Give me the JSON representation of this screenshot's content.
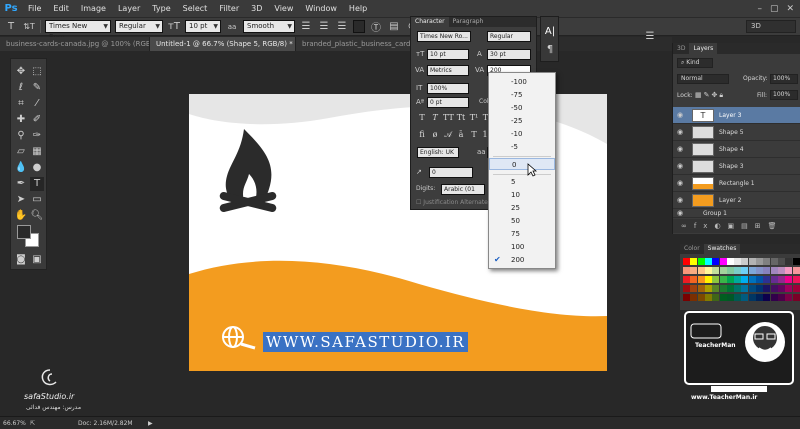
{
  "app": {
    "logo": "Ps"
  },
  "menu": [
    "File",
    "Edit",
    "Image",
    "Layer",
    "Type",
    "Select",
    "Filter",
    "3D",
    "View",
    "Window",
    "Help"
  ],
  "window_controls": [
    "–",
    "▢",
    "✕"
  ],
  "options_bar": {
    "font_family": "Times New Rom...",
    "font_style": "Regular",
    "font_size": "10 pt",
    "antialias_label": "aa",
    "antialias": "Smooth",
    "workspace": "3D"
  },
  "doc_tabs": [
    {
      "label": "business-cards-canada.jpg @ 100% (RGB/8#)",
      "active": false
    },
    {
      "label": "Untitled-1 @ 66.7% (Shape 5, RGB/8) *",
      "active": true
    },
    {
      "label": "branded_plastic_business_card_1.jpg",
      "active": false
    }
  ],
  "canvas": {
    "url_text": "WWW.SAFASTUDIO.IR",
    "colors": {
      "orange": "#f39c1f",
      "gray_wave": "#e6e6e6",
      "dark": "#2b2b2b",
      "selection": "#3a72c4"
    }
  },
  "character_panel": {
    "tabs": [
      "Character",
      "Paragraph"
    ],
    "font_family": "Times New Ro...",
    "font_style": "Regular",
    "font_size": "10 pt",
    "leading": "30 pt",
    "kerning": "Metrics",
    "tracking": "200",
    "vertical_scale": "100%",
    "baseline_shift": "0 pt",
    "color_label": "Colo",
    "language": "English: UK",
    "antialias_short": "Sm",
    "digits_label": "Digits:",
    "digits_value": "Arabic (01",
    "justification_label": "Justification Alternate",
    "mini_value": "0"
  },
  "tracking_dropdown": {
    "options": [
      "-100",
      "-75",
      "-50",
      "-25",
      "-10",
      "-5",
      "0",
      "5",
      "10",
      "25",
      "50",
      "75",
      "100",
      "200"
    ],
    "selected": "200",
    "highlighted": "0"
  },
  "layers_panel": {
    "tabs": [
      "3D",
      "Layers"
    ],
    "kind_label": "Kind",
    "blend_mode": "Normal",
    "opacity_label": "Opacity:",
    "opacity": "100%",
    "lock_label": "Lock:",
    "fill_label": "Fill:",
    "fill": "100%",
    "layers": [
      {
        "name": "Layer 3",
        "type": "text",
        "selected": true
      },
      {
        "name": "Shape 5",
        "type": "shape",
        "selected": false
      },
      {
        "name": "Shape 4",
        "type": "shape",
        "selected": false
      },
      {
        "name": "Shape 3",
        "type": "shape",
        "selected": false
      },
      {
        "name": "Rectangle 1",
        "type": "rect",
        "selected": false
      },
      {
        "name": "Layer 2",
        "type": "raster",
        "selected": false
      },
      {
        "name": "Group 1",
        "type": "group",
        "selected": false
      }
    ]
  },
  "swatches": {
    "tabs": [
      "Color",
      "Swatches"
    ],
    "colors": [
      "#ff0000",
      "#ffff00",
      "#00ff00",
      "#00ffff",
      "#0000ff",
      "#ff00ff",
      "#ffffff",
      "#e6e6e6",
      "#cccccc",
      "#b3b3b3",
      "#999999",
      "#808080",
      "#666666",
      "#4d4d4d",
      "#333333",
      "#000000",
      "#f7977a",
      "#f9ad81",
      "#fdc68a",
      "#fff79a",
      "#c4df9b",
      "#a3d39c",
      "#82ca9d",
      "#7bcdc8",
      "#6ecff6",
      "#7ea7d8",
      "#8493ca",
      "#8882be",
      "#a187be",
      "#bc8dbf",
      "#f49ac2",
      "#f6989d",
      "#ed1c24",
      "#f26522",
      "#f7941d",
      "#fff200",
      "#8dc63f",
      "#39b54a",
      "#00a651",
      "#00a99d",
      "#00aeef",
      "#0072bc",
      "#0054a6",
      "#2e3192",
      "#662d91",
      "#92278f",
      "#ec008c",
      "#ed145b",
      "#9e0b0f",
      "#a0410d",
      "#a36209",
      "#aba000",
      "#598527",
      "#1a7b30",
      "#007236",
      "#00746b",
      "#0076a3",
      "#004b80",
      "#003471",
      "#1b1464",
      "#440e62",
      "#630460",
      "#9e005d",
      "#9e0039",
      "#790000",
      "#7b2e00",
      "#7d4900",
      "#827b00",
      "#406618",
      "#005e20",
      "#005826",
      "#005952",
      "#005b7f",
      "#003663",
      "#002157",
      "#0d004c",
      "#32004b",
      "#4b0049",
      "#7b0046",
      "#7a0026"
    ]
  },
  "status_bar": {
    "zoom": "66.67%",
    "doc": "Doc: 2.16M/2.82M"
  },
  "watermarks": {
    "safa_site": "safaStudio.ir",
    "safa_persian": "مدرس: مهندس فدائی",
    "teacher_logo_lines": [
      "TeacherMan",
      "www.TeacherMan.ir"
    ]
  }
}
